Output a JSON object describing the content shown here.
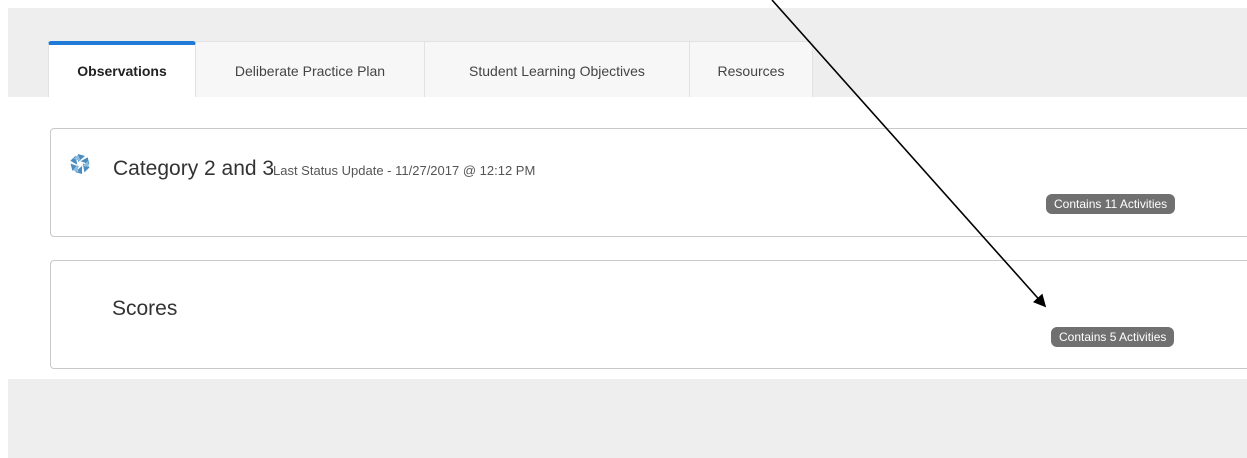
{
  "tabs": [
    {
      "label": "Observations",
      "active": true
    },
    {
      "label": "Deliberate Practice Plan",
      "active": false
    },
    {
      "label": "Student Learning Objectives",
      "active": false
    },
    {
      "label": "Resources",
      "active": false
    }
  ],
  "panels": [
    {
      "title": "Category 2 and 3",
      "status": "Last Status Update - 11/27/2017 @ 12:12 PM",
      "badge": "Contains 11 Activities",
      "icon": "pinwheel-status-icon"
    },
    {
      "title": "Scores",
      "badge": "Contains 5 Activities"
    }
  ],
  "colors": {
    "accent": "#1f7bd6",
    "badge": "#707070",
    "band": "#eeeeee",
    "icon": "#4a8cc0"
  }
}
